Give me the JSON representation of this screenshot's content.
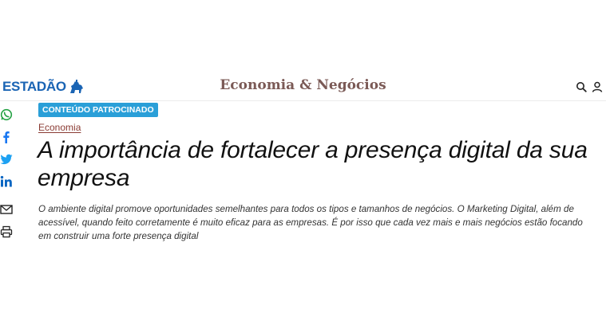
{
  "header": {
    "logo_text": "ESTADÃO",
    "logo_icon": "horse-rider-logo-icon",
    "section_title": "Economia & Negócios",
    "icons": [
      "search-icon",
      "user-icon"
    ]
  },
  "share": {
    "items": [
      "whatsapp-icon",
      "facebook-icon",
      "twitter-icon",
      "linkedin-icon",
      "email-icon",
      "print-icon"
    ]
  },
  "article": {
    "badge": "CONTEÚDO PATROCINADO",
    "category": "Economia",
    "headline": "A importância de fortalecer a presença digital da sua empresa",
    "summary": "O ambiente digital promove oportunidades semelhantes para todos os tipos e tamanhos de negócios. O Marketing Digital, além de acessível, quando feito corretamente é muito eficaz para as empresas. É por isso que cada vez mais e mais negócios estão focando em construir uma forte presença digital"
  },
  "colors": {
    "brand_blue": "#1a64b4",
    "section_brown": "#7b5a56",
    "badge_blue": "#2a9fd8",
    "category_red": "#8a3b33"
  }
}
